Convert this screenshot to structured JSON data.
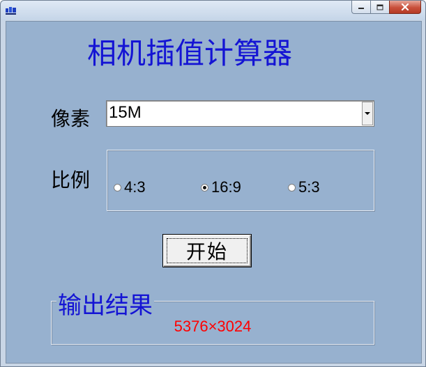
{
  "window": {
    "title": "",
    "icon": "app-window-icon",
    "controls": {
      "minimize_icon": "minimize-icon",
      "maximize_icon": "maximize-icon",
      "close_icon": "close-icon"
    }
  },
  "app": {
    "title": "相机插值计算器",
    "title_color": "#1414d4"
  },
  "pixels": {
    "label": "像素",
    "selected": "15M",
    "dropdown_icon": "chevron-down-icon"
  },
  "ratio": {
    "label": "比例",
    "options": [
      {
        "label": "4:3",
        "checked": false
      },
      {
        "label": "16:9",
        "checked": true
      },
      {
        "label": "5:3",
        "checked": false
      }
    ]
  },
  "actions": {
    "start_label": "开始"
  },
  "result": {
    "legend": "输出结果",
    "value": "5376×3024",
    "value_color": "#ff0000"
  },
  "colors": {
    "client_background": "#97b1cf",
    "close_button": "#c9503b"
  }
}
